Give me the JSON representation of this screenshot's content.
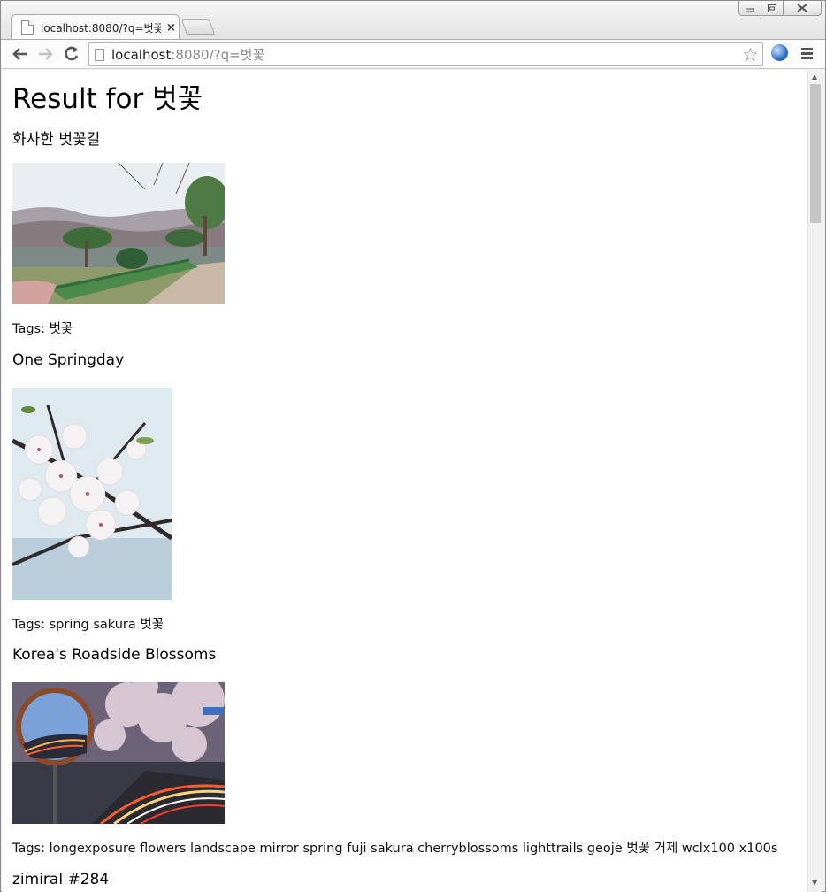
{
  "browser": {
    "tab_title": "localhost:8080/?q=벗꽃",
    "tab_close": "×",
    "url_host": "localhost",
    "url_rest": ":8080/?q=벗꽃"
  },
  "page": {
    "title": "Result for 벗꽃",
    "results": [
      {
        "title": "화사한 벗꽃길",
        "tags": "Tags: 벗꽃"
      },
      {
        "title": "One Springday",
        "tags": "Tags: spring sakura 벗꽃"
      },
      {
        "title": "Korea's Roadside Blossoms",
        "tags": "Tags: longexposure flowers landscape mirror spring fuji sakura cherryblossoms lighttrails geoje 벗꽃 거제 wclx100 x100s"
      },
      {
        "title": "zimiral #284"
      }
    ]
  },
  "icons": {
    "back": "back-arrow-icon",
    "forward": "forward-arrow-icon",
    "reload": "reload-icon",
    "page": "page-icon",
    "star": "star-icon",
    "extension": "globe-icon",
    "menu": "menu-icon"
  }
}
